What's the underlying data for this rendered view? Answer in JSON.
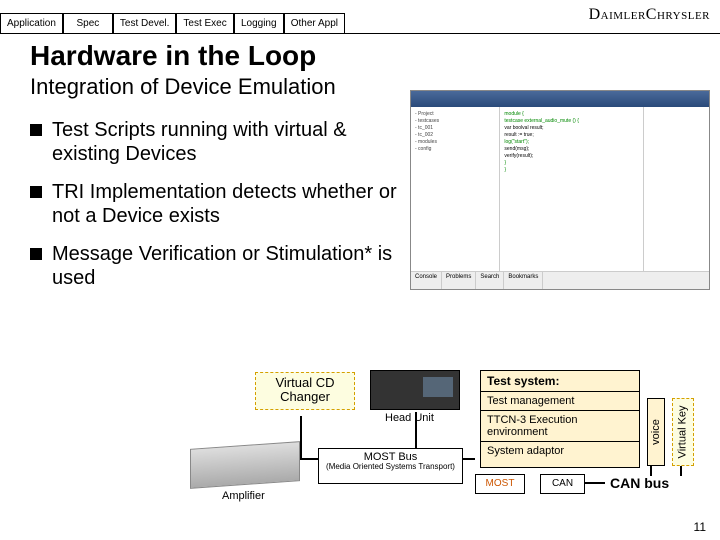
{
  "tabs": [
    "Application",
    "Spec",
    "Test Devel.",
    "Test Exec",
    "Logging",
    "Other Appl"
  ],
  "brand": "DaimlerChrysler",
  "title": "Hardware in the Loop",
  "subtitle": "Integration of Device Emulation",
  "bullets": [
    "Test Scripts running with virtual & existing Devices",
    "TRI Implementation detects whether or not a Device exists",
    "Message Verification or Stimulation* is used"
  ],
  "ide": {
    "tree": [
      "- Project",
      "  - testcases",
      "    - tc_001",
      "    - tc_002",
      "  - modules",
      "  - config"
    ],
    "code": [
      "module {",
      "  testcase external_audio_mute () {",
      "    var boolval result;",
      "    result := true;",
      "",
      "    log(\"start\");",
      "    send(msg);",
      "    verify(result);",
      "  }",
      "}"
    ],
    "bottom_tabs": [
      "Console",
      "Problems",
      "Search",
      "Bookmarks"
    ]
  },
  "diagram": {
    "virtual_cd": "Virtual CD Changer",
    "head_unit": "Head Unit",
    "test_system": {
      "header": "Test system:",
      "rows": [
        "Test management",
        "TTCN-3 Execution environment",
        "System adaptor"
      ]
    },
    "voice": "voice",
    "virtual_key": "Virtual Key",
    "amplifier": "Amplifier",
    "most_bus": "MOST Bus",
    "most_bus_sub": "(Media Oriented Systems Transport)",
    "most": "MOST",
    "can": "CAN",
    "can_bus": "CAN bus"
  },
  "page_number": "11"
}
